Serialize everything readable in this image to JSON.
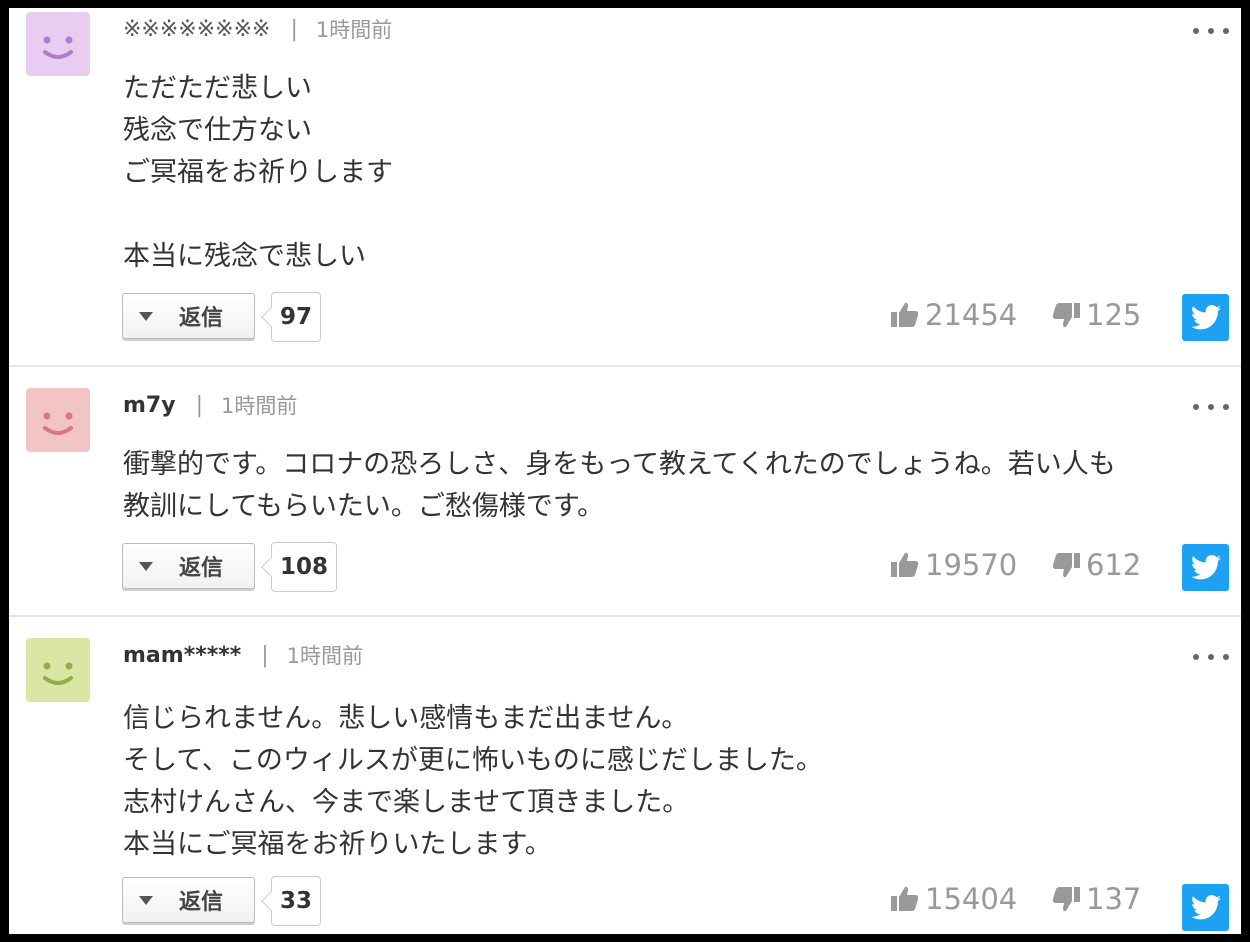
{
  "reply_label": "返信",
  "comments": [
    {
      "username": "※※※※※※※※",
      "separator": "|",
      "time": "1時間前",
      "avatar_color": "#e8cdf0",
      "avatar_face_color": "#b07cd0",
      "avatar_icon": "smiley-face-icon",
      "text": "ただただ悲しい\n残念で仕方ない\nご冥福をお祈りします\n\n本当に残念で悲しい",
      "reply_count": "97",
      "likes": "21454",
      "dislikes": "125"
    },
    {
      "username": "m7y",
      "separator": "|",
      "time": "1時間前",
      "avatar_color": "#f3c4c6",
      "avatar_face_color": "#d9787e",
      "avatar_icon": "smiley-face-icon",
      "text": "衝撃的です。コロナの恐ろしさ、身をもって教えてくれたのでしょうね。若い人も\n教訓にしてもらいたい。ご愁傷様です。",
      "reply_count": "108",
      "likes": "19570",
      "dislikes": "612"
    },
    {
      "username": "mam*****",
      "separator": "|",
      "time": "1時間前",
      "avatar_color": "#d9e6a4",
      "avatar_face_color": "#95ad46",
      "avatar_icon": "smiley-face-icon",
      "text": "信じられません。悲しい感情もまだ出ません。\nそして、このウィルスが更に怖いものに感じだしました。\n志村けんさん、今まで楽しませて頂きました。\n本当にご冥福をお祈りいたします。",
      "reply_count": "33",
      "likes": "15404",
      "dislikes": "137"
    }
  ],
  "icons": {
    "more": "more-options-icon",
    "like": "thumbs-up-icon",
    "dislike": "thumbs-down-icon",
    "share": "twitter-icon",
    "reply_toggle": "triangle-down-icon"
  },
  "colors": {
    "twitter": "#1da1f2",
    "vote_text": "#999999",
    "body_text": "#333333"
  }
}
